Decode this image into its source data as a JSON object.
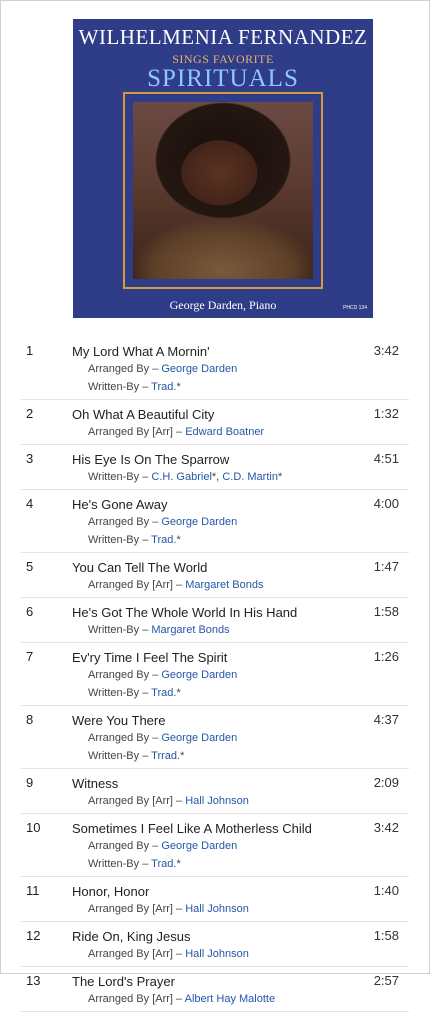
{
  "album": {
    "artist": "WILHELMENIA FERNANDEZ",
    "subtitle": "SINGS FAVORITE",
    "title": "SPIRITUALS",
    "credit": "George Darden, Piano",
    "catalog": "PHCD 134"
  },
  "tracks": [
    {
      "num": "1",
      "title": "My Lord What A Mornin'",
      "duration": "3:42",
      "credits": [
        {
          "role": "Arranged By – ",
          "names": [
            {
              "name": "George Darden",
              "suffix": ""
            }
          ]
        },
        {
          "role": "Written-By – ",
          "names": [
            {
              "name": "Trad.",
              "suffix": "*"
            }
          ]
        }
      ]
    },
    {
      "num": "2",
      "title": "Oh What A Beautiful City",
      "duration": "1:32",
      "credits": [
        {
          "role": "Arranged By [Arr] – ",
          "names": [
            {
              "name": "Edward Boatner",
              "suffix": ""
            }
          ]
        }
      ]
    },
    {
      "num": "3",
      "title": "His Eye Is On The Sparrow",
      "duration": "4:51",
      "credits": [
        {
          "role": "Written-By – ",
          "names": [
            {
              "name": "C.H. Gabriel",
              "suffix": "*, "
            },
            {
              "name": "C.D. Martin",
              "suffix": "*"
            }
          ]
        }
      ]
    },
    {
      "num": "4",
      "title": "He's Gone Away",
      "duration": "4:00",
      "credits": [
        {
          "role": "Arranged By – ",
          "names": [
            {
              "name": "George Darden",
              "suffix": ""
            }
          ]
        },
        {
          "role": "Written-By – ",
          "names": [
            {
              "name": "Trad.",
              "suffix": "*"
            }
          ]
        }
      ]
    },
    {
      "num": "5",
      "title": "You Can Tell The World",
      "duration": "1:47",
      "credits": [
        {
          "role": "Arranged By [Arr] – ",
          "names": [
            {
              "name": "Margaret Bonds",
              "suffix": ""
            }
          ]
        }
      ]
    },
    {
      "num": "6",
      "title": "He's Got The Whole World In His Hand",
      "duration": "1:58",
      "credits": [
        {
          "role": "Written-By – ",
          "names": [
            {
              "name": "Margaret Bonds",
              "suffix": ""
            }
          ]
        }
      ]
    },
    {
      "num": "7",
      "title": "Ev'ry Time I Feel The Spirit",
      "duration": "1:26",
      "credits": [
        {
          "role": "Arranged By – ",
          "names": [
            {
              "name": "George Darden",
              "suffix": ""
            }
          ]
        },
        {
          "role": "Written-By – ",
          "names": [
            {
              "name": "Trad.",
              "suffix": "*"
            }
          ]
        }
      ]
    },
    {
      "num": "8",
      "title": "Were You There",
      "duration": "4:37",
      "credits": [
        {
          "role": "Arranged By – ",
          "names": [
            {
              "name": "George Darden",
              "suffix": ""
            }
          ]
        },
        {
          "role": "Written-By – ",
          "names": [
            {
              "name": "Trrad.",
              "suffix": "*"
            }
          ]
        }
      ]
    },
    {
      "num": "9",
      "title": "Witness",
      "duration": "2:09",
      "credits": [
        {
          "role": "Arranged By [Arr] – ",
          "names": [
            {
              "name": "Hall Johnson",
              "suffix": ""
            }
          ]
        }
      ]
    },
    {
      "num": "10",
      "title": "Sometimes I Feel Like A Motherless Child",
      "duration": "3:42",
      "credits": [
        {
          "role": "Arranged By – ",
          "names": [
            {
              "name": "George Darden",
              "suffix": ""
            }
          ]
        },
        {
          "role": "Written-By – ",
          "names": [
            {
              "name": "Trad.",
              "suffix": "*"
            }
          ]
        }
      ]
    },
    {
      "num": "11",
      "title": "Honor, Honor",
      "duration": "1:40",
      "credits": [
        {
          "role": "Arranged By [Arr] – ",
          "names": [
            {
              "name": "Hall Johnson",
              "suffix": ""
            }
          ]
        }
      ]
    },
    {
      "num": "12",
      "title": "Ride On, King Jesus",
      "duration": "1:58",
      "credits": [
        {
          "role": "Arranged By [Arr] – ",
          "names": [
            {
              "name": "Hall Johnson",
              "suffix": ""
            }
          ]
        }
      ]
    },
    {
      "num": "13",
      "title": "The Lord's Prayer",
      "duration": "2:57",
      "credits": [
        {
          "role": "Arranged By [Arr] – ",
          "names": [
            {
              "name": "Albert Hay Malotte",
              "suffix": ""
            }
          ]
        }
      ]
    }
  ],
  "colors": {
    "link": "#2457a6",
    "cover_bg": "#2f3c88",
    "frame_gold": "#d59a3a"
  }
}
